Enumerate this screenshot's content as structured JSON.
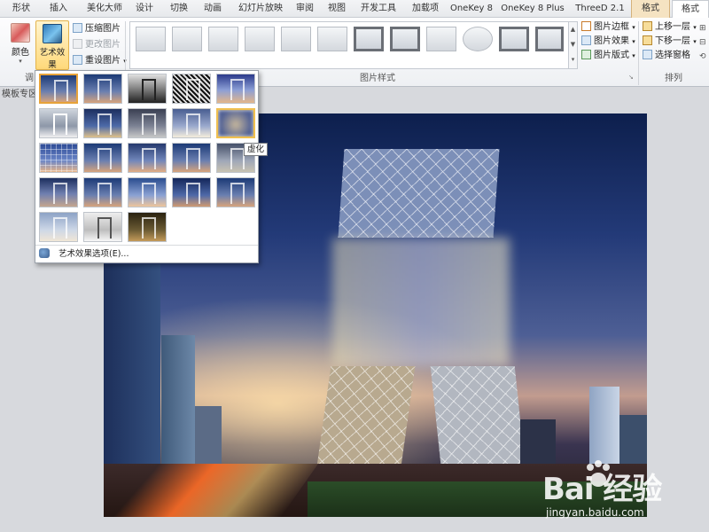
{
  "tabs": [
    {
      "label": "形状"
    },
    {
      "label": "插入"
    },
    {
      "label": "美化大师"
    },
    {
      "label": "设计"
    },
    {
      "label": "切换"
    },
    {
      "label": "动画"
    },
    {
      "label": "幻灯片放映"
    },
    {
      "label": "审阅"
    },
    {
      "label": "视图"
    },
    {
      "label": "开发工具"
    },
    {
      "label": "加载项"
    },
    {
      "label": "OneKey 8"
    },
    {
      "label": "OneKey 8 Plus"
    },
    {
      "label": "ThreeD 2.1"
    },
    {
      "label": "格式"
    },
    {
      "label": "格式"
    }
  ],
  "adjust": {
    "color_label": "颜色",
    "art_effects_label": "艺术效果",
    "compress_label": "压缩图片",
    "change_label": "更改图片",
    "reset_label": "重设图片",
    "group_label": "调"
  },
  "picture_styles": {
    "group_label": "图片样式",
    "border_label": "图片边框",
    "effects_label": "图片效果",
    "layout_label": "图片版式"
  },
  "arrange": {
    "group_label": "排列",
    "bring_forward": "上移一层",
    "send_backward": "下移一层",
    "selection_pane": "选择窗格"
  },
  "left_panel_label": "模板专区",
  "gallery": {
    "option_label": "艺术效果选项(E)...",
    "tooltip": "虚化"
  },
  "watermark": {
    "logo": "Bai 经验",
    "url": "jingyan.baidu.com"
  },
  "colors": {
    "ctx_tab": "#f5e3c2",
    "highlight": "#ffd97a"
  }
}
